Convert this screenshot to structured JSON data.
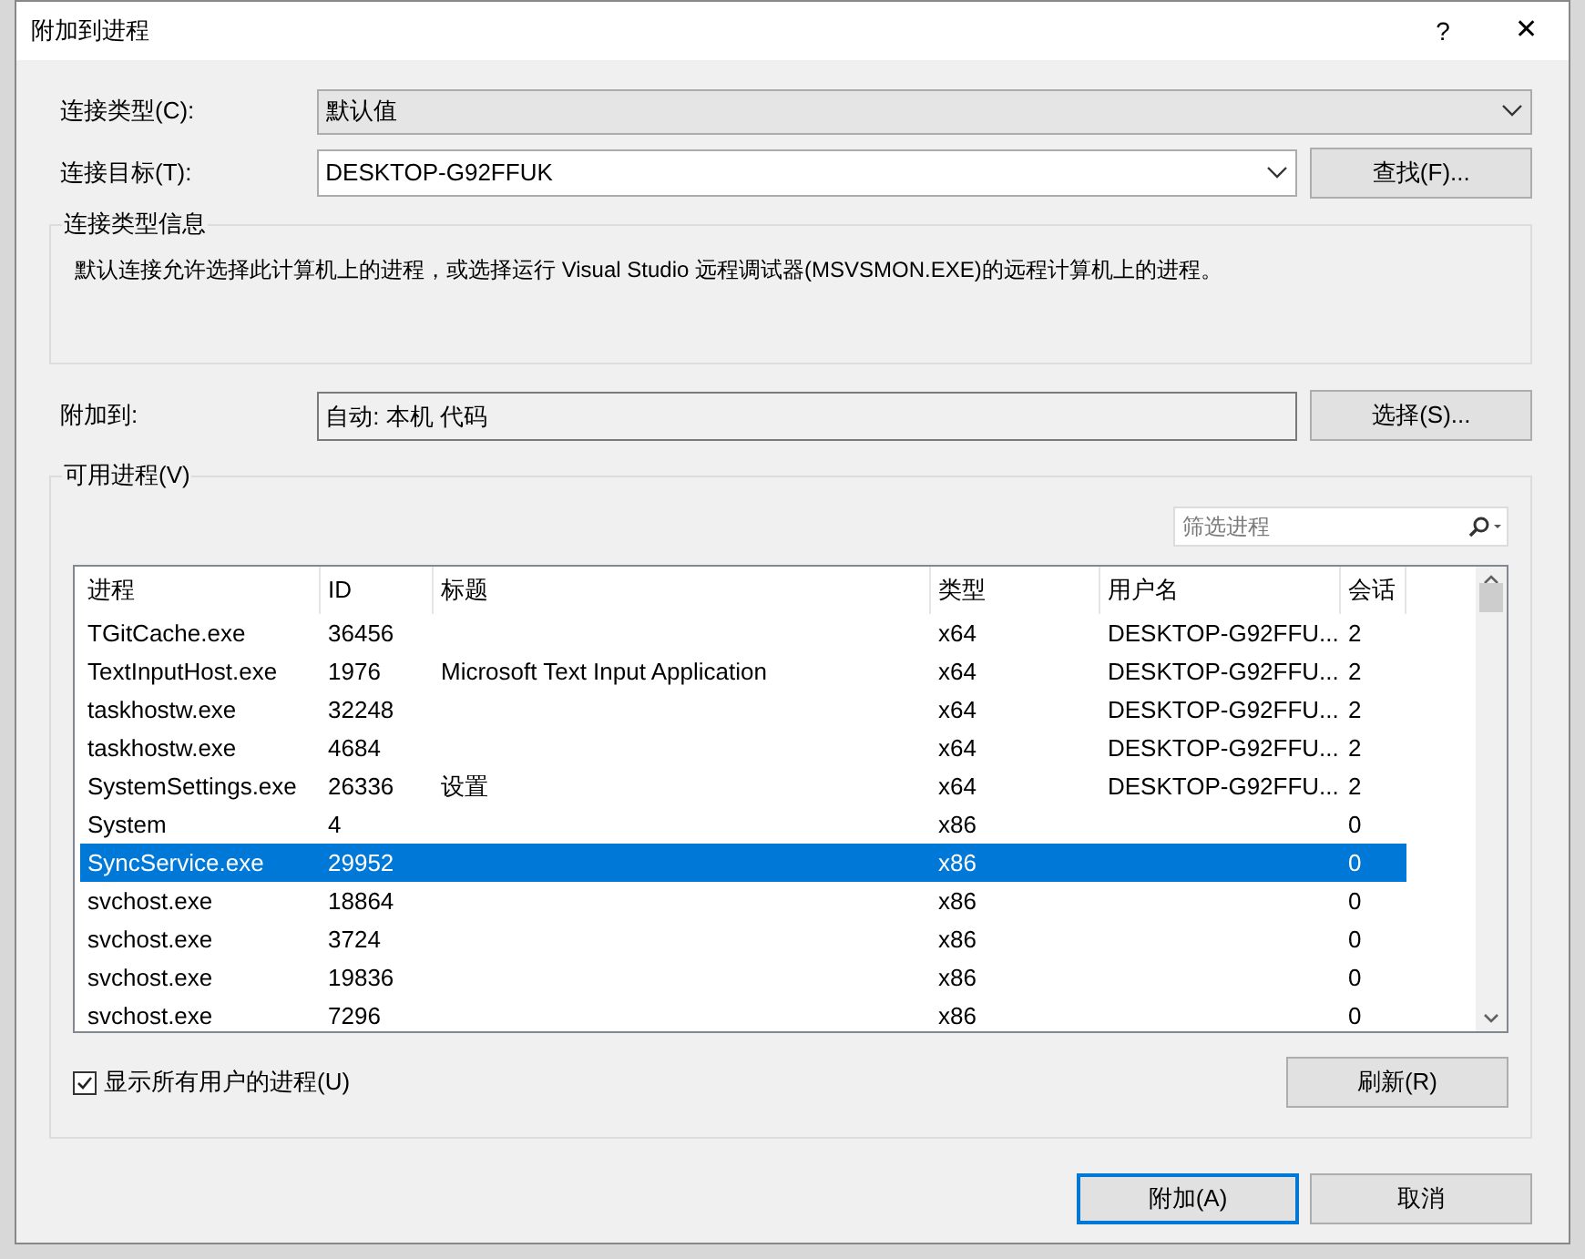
{
  "window": {
    "title": "附加到进程",
    "help": "?",
    "close": "✕"
  },
  "connection_type": {
    "label": "连接类型(C):",
    "value": "默认值"
  },
  "connection_target": {
    "label": "连接目标(T):",
    "value": "DESKTOP-G92FFUK",
    "button": "查找(F)..."
  },
  "info_group": {
    "title": "连接类型信息",
    "text": "默认连接允许选择此计算机上的进程，或选择运行 Visual Studio 远程调试器(MSVSMON.EXE)的远程计算机上的进程。"
  },
  "attach_to": {
    "label": "附加到:",
    "value": "自动: 本机 代码",
    "button": "选择(S)..."
  },
  "processes": {
    "title": "可用进程(V)",
    "filter": {
      "placeholder": "筛选进程"
    },
    "columns": [
      "进程",
      "ID",
      "标题",
      "类型",
      "用户名",
      "会话"
    ],
    "rows": [
      {
        "cells": [
          "TGitCache.exe",
          "36456",
          "",
          "x64",
          "DESKTOP-G92FFU...",
          "2"
        ],
        "selected": false
      },
      {
        "cells": [
          "TextInputHost.exe",
          "1976",
          "Microsoft Text Input Application",
          "x64",
          "DESKTOP-G92FFU...",
          "2"
        ],
        "selected": false
      },
      {
        "cells": [
          "taskhostw.exe",
          "32248",
          "",
          "x64",
          "DESKTOP-G92FFU...",
          "2"
        ],
        "selected": false
      },
      {
        "cells": [
          "taskhostw.exe",
          "4684",
          "",
          "x64",
          "DESKTOP-G92FFU...",
          "2"
        ],
        "selected": false
      },
      {
        "cells": [
          "SystemSettings.exe",
          "26336",
          "设置",
          "x64",
          "DESKTOP-G92FFU...",
          "2"
        ],
        "selected": false
      },
      {
        "cells": [
          "System",
          "4",
          "",
          "x86",
          "",
          "0"
        ],
        "selected": false
      },
      {
        "cells": [
          "SyncService.exe",
          "29952",
          "",
          "x86",
          "",
          "0"
        ],
        "selected": true
      },
      {
        "cells": [
          "svchost.exe",
          "18864",
          "",
          "x86",
          "",
          "0"
        ],
        "selected": false
      },
      {
        "cells": [
          "svchost.exe",
          "3724",
          "",
          "x86",
          "",
          "0"
        ],
        "selected": false
      },
      {
        "cells": [
          "svchost.exe",
          "19836",
          "",
          "x86",
          "",
          "0"
        ],
        "selected": false
      },
      {
        "cells": [
          "svchost.exe",
          "7296",
          "",
          "x86",
          "",
          "0"
        ],
        "selected": false
      }
    ],
    "show_all_users": {
      "label": "显示所有用户的进程(U)",
      "checked": true
    },
    "refresh": "刷新(R)"
  },
  "buttons": [
    {
      "label": "附加(A)",
      "default": true
    },
    {
      "label": "取消",
      "default": false
    }
  ]
}
